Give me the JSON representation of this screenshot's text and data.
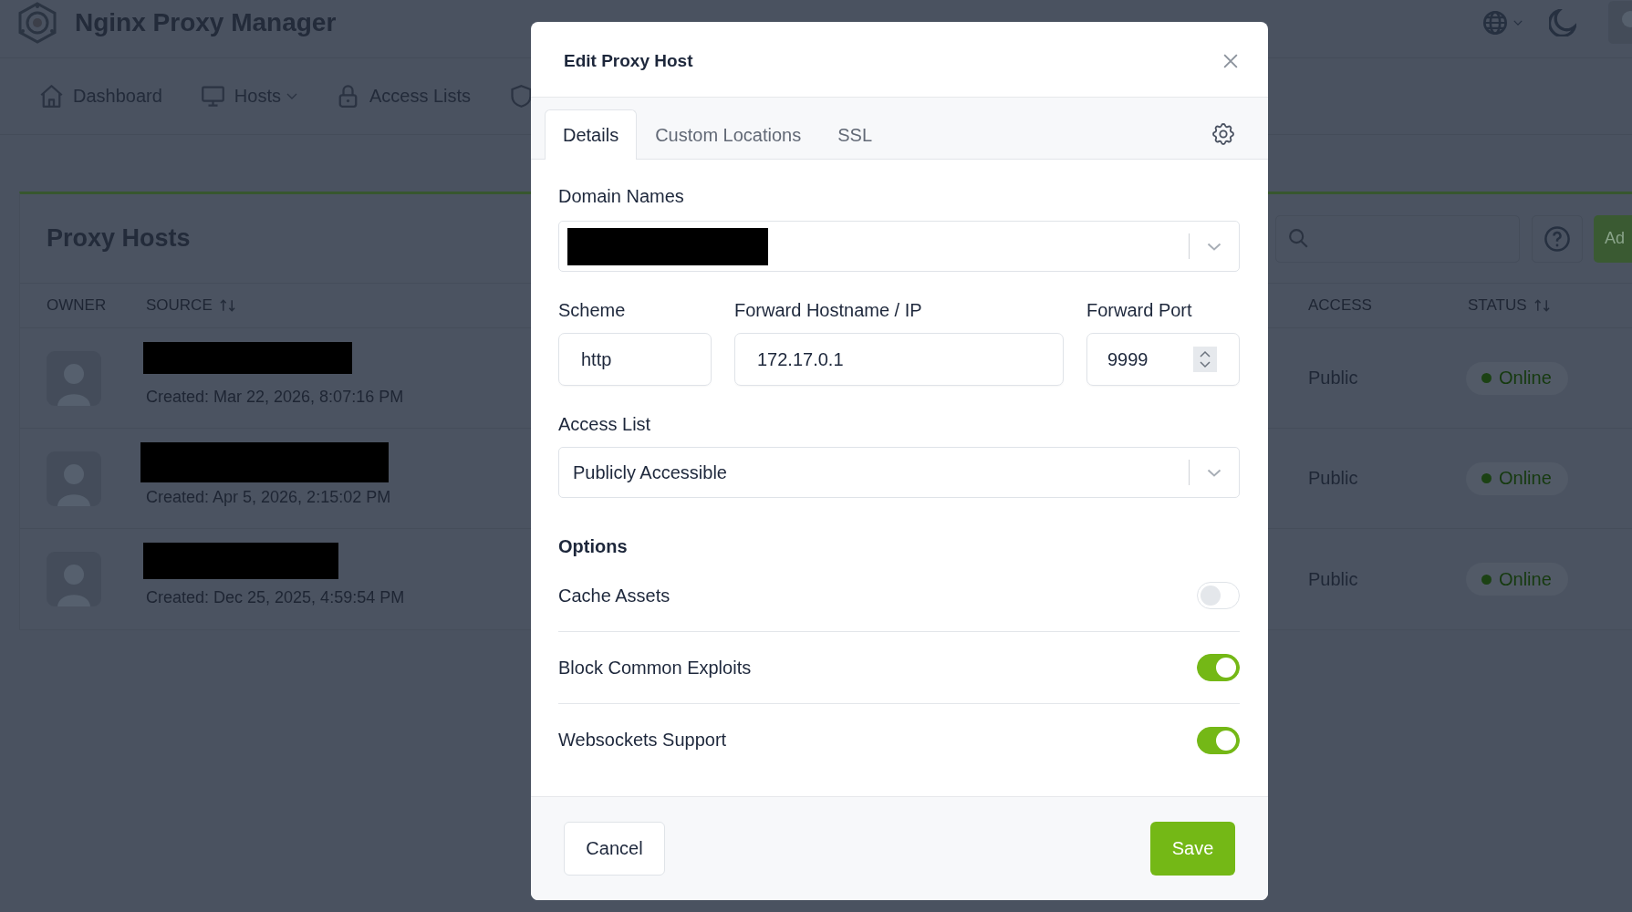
{
  "app": {
    "title": "Nginx Proxy Manager"
  },
  "nav": [
    {
      "label": "Dashboard",
      "dropdown": false
    },
    {
      "label": "Hosts",
      "dropdown": true
    },
    {
      "label": "Access Lists",
      "dropdown": false
    }
  ],
  "proxy_hosts": {
    "title": "Proxy Hosts",
    "add_button": "Ad",
    "columns": [
      {
        "label": "OWNER",
        "sortable": false
      },
      {
        "label": "SOURCE",
        "sortable": true
      },
      {
        "label": "ACCESS",
        "sortable": false
      },
      {
        "label": "STATUS",
        "sortable": true
      }
    ],
    "rows": [
      {
        "source_redacted": true,
        "created": "Created: Mar 22, 2026, 8:07:16 PM",
        "access": "Public",
        "status": {
          "label": "Online",
          "kind": "online"
        }
      },
      {
        "source_redacted": true,
        "created": "Created: Apr 5, 2026, 2:15:02 PM",
        "access": "Public",
        "status": {
          "label": "Online",
          "kind": "online"
        }
      },
      {
        "source_redacted": true,
        "created": "Created: Dec 25, 2025, 4:59:54 PM",
        "access": "Public",
        "status": {
          "label": "Online",
          "kind": "online"
        }
      }
    ]
  },
  "modal": {
    "title": "Edit Proxy Host",
    "tabs": [
      {
        "label": "Details",
        "selected": true
      },
      {
        "label": "Custom Locations",
        "selected": false
      },
      {
        "label": "SSL",
        "selected": false
      }
    ],
    "domain_names": {
      "label": "Domain Names",
      "redacted": true
    },
    "scheme": {
      "label": "Scheme",
      "value": "http"
    },
    "forward_host": {
      "label": "Forward Hostname / IP",
      "value": "172.17.0.1"
    },
    "forward_port": {
      "label": "Forward Port",
      "value": "9999"
    },
    "access_list": {
      "label": "Access List",
      "value": "Publicly Accessible"
    },
    "options": {
      "title": "Options",
      "items": [
        {
          "label": "Cache Assets",
          "on": false
        },
        {
          "label": "Block Common Exploits",
          "on": true
        },
        {
          "label": "Websockets Support",
          "on": true
        }
      ]
    },
    "cancel_button": "Cancel",
    "save_button": "Save"
  }
}
